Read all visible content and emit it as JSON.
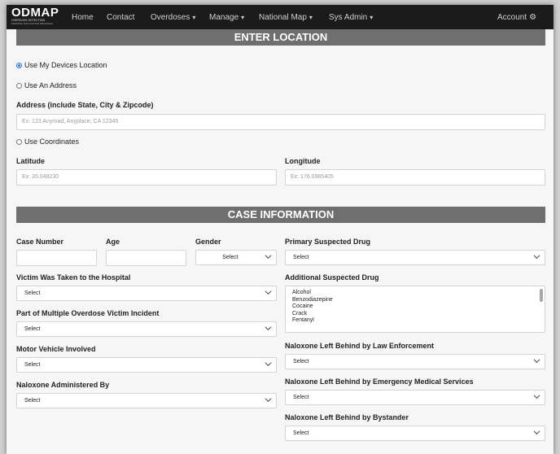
{
  "nav": {
    "logo": "ODMAP",
    "logo_sub1": "OVERDOSE DETECTION",
    "logo_sub2": "MAPPING APPLICATION PROGRAM",
    "home": "Home",
    "contact": "Contact",
    "overdoses": "Overdoses",
    "manage": "Manage",
    "national_map": "National Map",
    "sys_admin": "Sys Admin",
    "account": "Account"
  },
  "location": {
    "header": "ENTER LOCATION",
    "use_device": "Use My Devices Location",
    "use_address": "Use An Address",
    "address_label": "Address (include State, City & Zipcode)",
    "address_placeholder": "Ex: 123 Anyroad, Anyplace, CA 12345",
    "use_coords": "Use Coordinates",
    "lat_label": "Latitude",
    "lat_placeholder": "Ex: 35.048230",
    "lon_label": "Longitude",
    "lon_placeholder": "Ex: 176.0985405"
  },
  "case": {
    "header": "CASE INFORMATION",
    "case_number": "Case Number",
    "age": "Age",
    "gender": "Gender",
    "gender_value": "Select",
    "primary_drug": "Primary Suspected Drug",
    "primary_drug_value": "Select",
    "hospital": "Victim Was Taken to the Hospital",
    "hospital_value": "Select",
    "additional_drug": "Additional Suspected Drug",
    "additional_drug_options": [
      "Alcohol",
      "Benzodiazepine",
      "Cocaine",
      "Crack",
      "Fentanyl"
    ],
    "multiple": "Part of Multiple Overdose Victim Incident",
    "multiple_value": "Select",
    "vehicle": "Motor Vehicle Involved",
    "vehicle_value": "Select",
    "nalox_law": "Naloxone Left Behind by Law Enforcement",
    "nalox_law_value": "Select",
    "nalox_admin": "Naloxone Administered By",
    "nalox_admin_value": "Select",
    "nalox_ems": "Naloxone Left Behind by Emergency Medical Services",
    "nalox_ems_value": "Select",
    "nalox_bystander": "Naloxone Left Behind by Bystander",
    "nalox_bystander_value": "Select"
  },
  "colors": {
    "navbar": "#1b1b1b",
    "section_header": "#6f6f6f",
    "radio_accent": "#2a6fdb"
  }
}
